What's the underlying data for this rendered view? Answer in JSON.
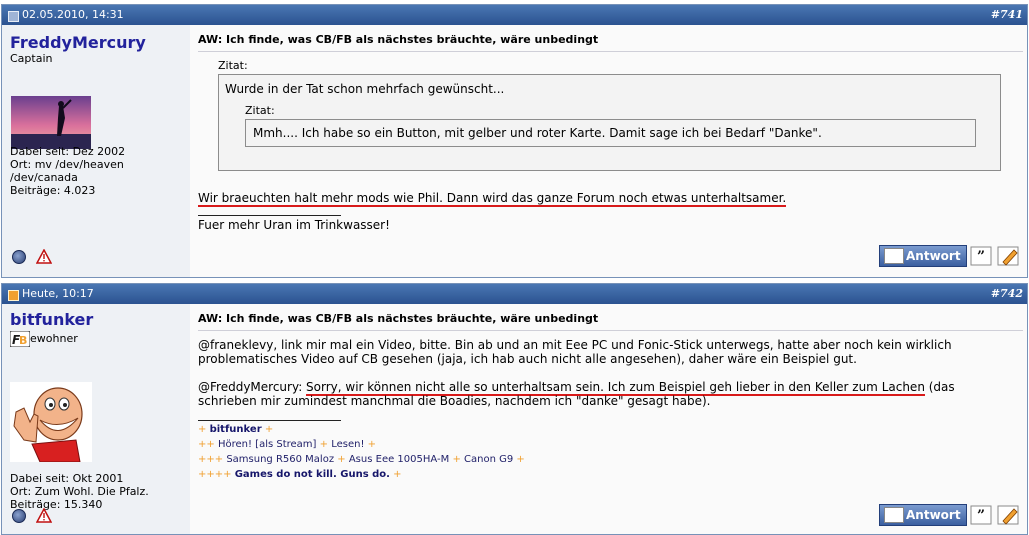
{
  "posts": [
    {
      "date": "02.05.2010, 14:31",
      "number": "#741",
      "username": "FreddyMercury",
      "user_title": "Captain",
      "info": [
        "Dabei seit: Dez 2002",
        "Ort: mv /dev/heaven",
        "/dev/canada",
        "Beiträge: 4.023"
      ],
      "title": "AW: Ich finde, was CB/FB als nächstes bräuchte, wäre unbedingt",
      "quote_label": "Zitat:",
      "quote_text": "Wurde in der Tat schon mehrfach gewünscht...",
      "nested_quote_label": "Zitat:",
      "nested_quote_text": "Mmh.... Ich habe so ein Button, mit gelber und roter Karte. Damit sage ich bei Bedarf \"Danke\".",
      "body_text": "Wir braeuchten halt mehr mods wie Phil. Dann wird das ganze Forum noch etwas unterhaltsamer.",
      "signature": "Fuer mehr Uran im Trinkwasser!",
      "reply_label": "Antwort"
    },
    {
      "date": "Heute, 10:17",
      "number": "#742",
      "username": "bitfunker",
      "user_title_suffix": "ewohner",
      "info": [
        "Dabei seit: Okt 2001",
        "Ort: Zum Wohl. Die Pfalz.",
        "Beiträge: 15.340"
      ],
      "title": "AW: Ich finde, was CB/FB als nächstes bräuchte, wäre unbedingt",
      "para1_line1": "@franeklevy, link mir mal ein Video, bitte. Bin ab und an mit Eee PC und Fonic-Stick unterwegs, hatte aber noch kein wirklich",
      "para1_line2": "problematisches Video auf CB gesehen (jaja, ich hab auch nicht alle angesehen), daher wäre ein Beispiel gut.",
      "para2_prefix": "@FreddyMercury: ",
      "para2_underlined": "Sorry, wir können nicht alle so unterhaltsam sein. Ich zum Beispiel geh lieber in den Keller zum Lachen",
      "para2_suffix": " (das",
      "para2_line2": "schrieben mir zumindest manchmal die Boadies, nachdem ich \"danke\" gesagt habe).",
      "sig": {
        "name": "bitfunker",
        "listen_a": "Hören!",
        "stream": "[als Stream]",
        "listen_b": "Lesen!",
        "device1": "Samsung R560 Maloz",
        "device2": "Asus Eee 1005HA-M",
        "device3": "Canon G9",
        "motto": "Games do not kill. Guns do."
      },
      "reply_label": "Antwort"
    }
  ]
}
